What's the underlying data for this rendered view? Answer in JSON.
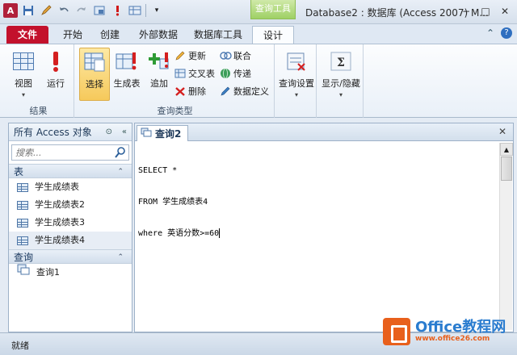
{
  "window": {
    "title": "Database2 : 数据库 (Access 2007) M...",
    "contextual_tab_group": "查询工具",
    "controls": {
      "minimize": "−",
      "maximize": "□",
      "close": "✕"
    }
  },
  "qat_icons": [
    "access-app-icon",
    "save-icon",
    "undo-icon",
    "redo-icon",
    "view-icon",
    "alert-icon",
    "table-icon",
    "customize-icon"
  ],
  "tabs": [
    {
      "label": "文件"
    },
    {
      "label": "开始"
    },
    {
      "label": "创建"
    },
    {
      "label": "外部数据"
    },
    {
      "label": "数据库工具"
    },
    {
      "label": "设计"
    }
  ],
  "ribbon": {
    "results_group": {
      "label": "结果",
      "view_label": "视图",
      "run_label": "运行"
    },
    "query_type_group": {
      "label": "查询类型",
      "select_label": "选择",
      "make_table_label": "生成表",
      "append_label": "追加",
      "update_label": "更新",
      "crosstab_label": "交叉表",
      "delete_label": "删除",
      "union_label": "联合",
      "passthrough_label": "传递",
      "data_definition_label": "数据定义"
    },
    "query_setup_label": "查询设置",
    "show_hide_label": "显示/隐藏"
  },
  "nav": {
    "header": "所有 Access 对象",
    "search_placeholder": "搜索...",
    "sections": [
      {
        "title": "表",
        "items": [
          {
            "label": "学生成绩表"
          },
          {
            "label": "学生成绩表2"
          },
          {
            "label": "学生成绩表3"
          },
          {
            "label": "学生成绩表4"
          }
        ]
      },
      {
        "title": "查询",
        "items": [
          {
            "label": "查询1"
          }
        ]
      }
    ]
  },
  "document": {
    "tab_label": "查询2",
    "sql_lines": [
      "SELECT *",
      "FROM 学生成绩表4",
      "where 英语分数>=60"
    ]
  },
  "status": {
    "text": "就绪"
  },
  "watermark": {
    "brand": "Office教程网",
    "url": "www.office26.com"
  },
  "colors": {
    "file_tab": "#c3112c",
    "contextual": "#9fd065",
    "accent": "#4f7bb2"
  }
}
